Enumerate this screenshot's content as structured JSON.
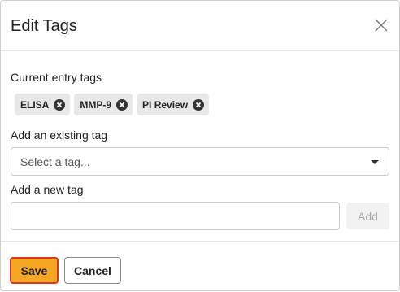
{
  "dialog": {
    "title": "Edit Tags",
    "close_icon": "close-icon"
  },
  "current_tags": {
    "label": "Current entry tags",
    "tags": [
      {
        "label": "ELISA",
        "remove_icon": "remove-circle-icon"
      },
      {
        "label": "MMP-9",
        "remove_icon": "remove-circle-icon"
      },
      {
        "label": "PI Review",
        "remove_icon": "remove-circle-icon"
      }
    ]
  },
  "existing_tag": {
    "label": "Add an existing tag",
    "placeholder": "Select a tag...",
    "caret_icon": "caret-down-icon"
  },
  "new_tag": {
    "label": "Add a new tag",
    "value": "",
    "add_label": "Add"
  },
  "footer": {
    "save_label": "Save",
    "cancel_label": "Cancel"
  },
  "colors": {
    "save_background": "#f5a623",
    "save_border": "#d93a1f",
    "tag_background": "#e8e8e8"
  }
}
